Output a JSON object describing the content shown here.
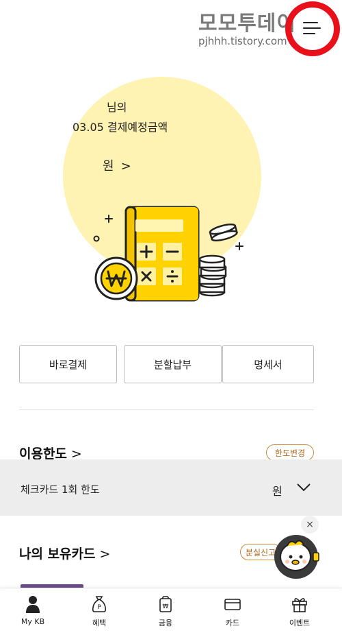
{
  "watermark": {
    "title": "모모투데이",
    "url": "pjhhh.tistory.com"
  },
  "summary": {
    "name_suffix": "님의",
    "due_label": "03.05 결제예정금액",
    "amount_unit": "원",
    "amount_chevron": ">"
  },
  "actions": [
    {
      "label": "바로결제"
    },
    {
      "label": "분할납부"
    },
    {
      "label": "명세서"
    }
  ],
  "usage_limit": {
    "title": "이용한도",
    "chevron": ">",
    "change_button": "한도변경",
    "check_card_label": "체크카드 1회 한도",
    "unit": "원"
  },
  "my_cards": {
    "title": "나의 보유카드",
    "chevron": ">",
    "report_button": "분실신고"
  },
  "popup_close": "×",
  "bottom_nav": [
    {
      "label": "My KB",
      "icon": "person-icon"
    },
    {
      "label": "혜택",
      "icon": "benefit-bag-icon"
    },
    {
      "label": "금융",
      "icon": "finance-won-bag-icon"
    },
    {
      "label": "카드",
      "icon": "card-icon"
    },
    {
      "label": "이벤트",
      "icon": "gift-icon"
    }
  ],
  "colors": {
    "accent_yellow": "#ffd200",
    "hero_bg": "#fff3b3",
    "pill_border": "#c98a3a",
    "highlight_ring": "#e8101a"
  }
}
